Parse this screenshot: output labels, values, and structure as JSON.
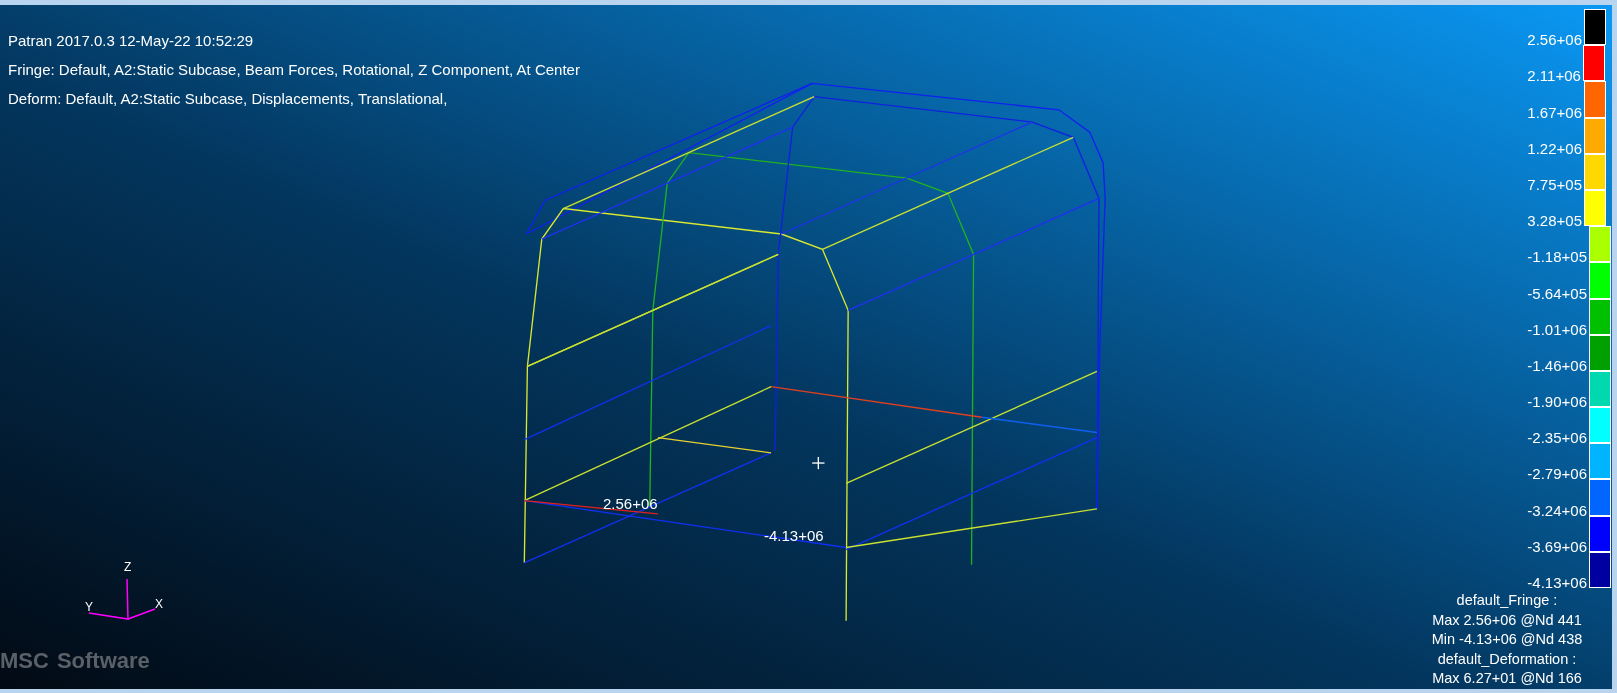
{
  "viewport": {
    "header_lines": [
      "Patran 2017.0.3 12-May-22 10:52:29",
      "Fringe: Default, A2:Static Subcase, Beam Forces, Rotational, Z Component, At Center",
      "Deform: Default, A2:Static Subcase, Displacements, Translational,"
    ],
    "legend": [
      {
        "label": "2.56+06",
        "color": "#000000"
      },
      {
        "label": "2.11+06",
        "color": "#ff0000"
      },
      {
        "label": "1.67+06",
        "color": "#ff6600"
      },
      {
        "label": "1.22+06",
        "color": "#ffaa00"
      },
      {
        "label": "7.75+05",
        "color": "#ffd800"
      },
      {
        "label": "3.28+05",
        "color": "#ffff00"
      },
      {
        "label": "-1.18+05",
        "color": "#aaff00"
      },
      {
        "label": "-5.64+05",
        "color": "#00ff00"
      },
      {
        "label": "-1.01+06",
        "color": "#00c000"
      },
      {
        "label": "-1.46+06",
        "color": "#00a000"
      },
      {
        "label": "-1.90+06",
        "color": "#00d8b0"
      },
      {
        "label": "-2.35+06",
        "color": "#00ffff"
      },
      {
        "label": "-2.79+06",
        "color": "#00b4ff"
      },
      {
        "label": "-3.24+06",
        "color": "#0066ff"
      },
      {
        "label": "-3.69+06",
        "color": "#0000ff"
      },
      {
        "label": "-4.13+06",
        "color": "#0000a0"
      }
    ],
    "summary": [
      "default_Fringe :",
      "Max 2.56+06 @Nd 441",
      "Min -4.13+06 @Nd 438",
      "default_Deformation :",
      "Max 6.27+01 @Nd 166"
    ],
    "plot_labels": [
      "2.56+06",
      "-4.13+06"
    ],
    "axes": {
      "x": "X",
      "y": "Y",
      "z": "Z"
    },
    "logo": {
      "left": "MSC",
      "right": "Software"
    }
  }
}
